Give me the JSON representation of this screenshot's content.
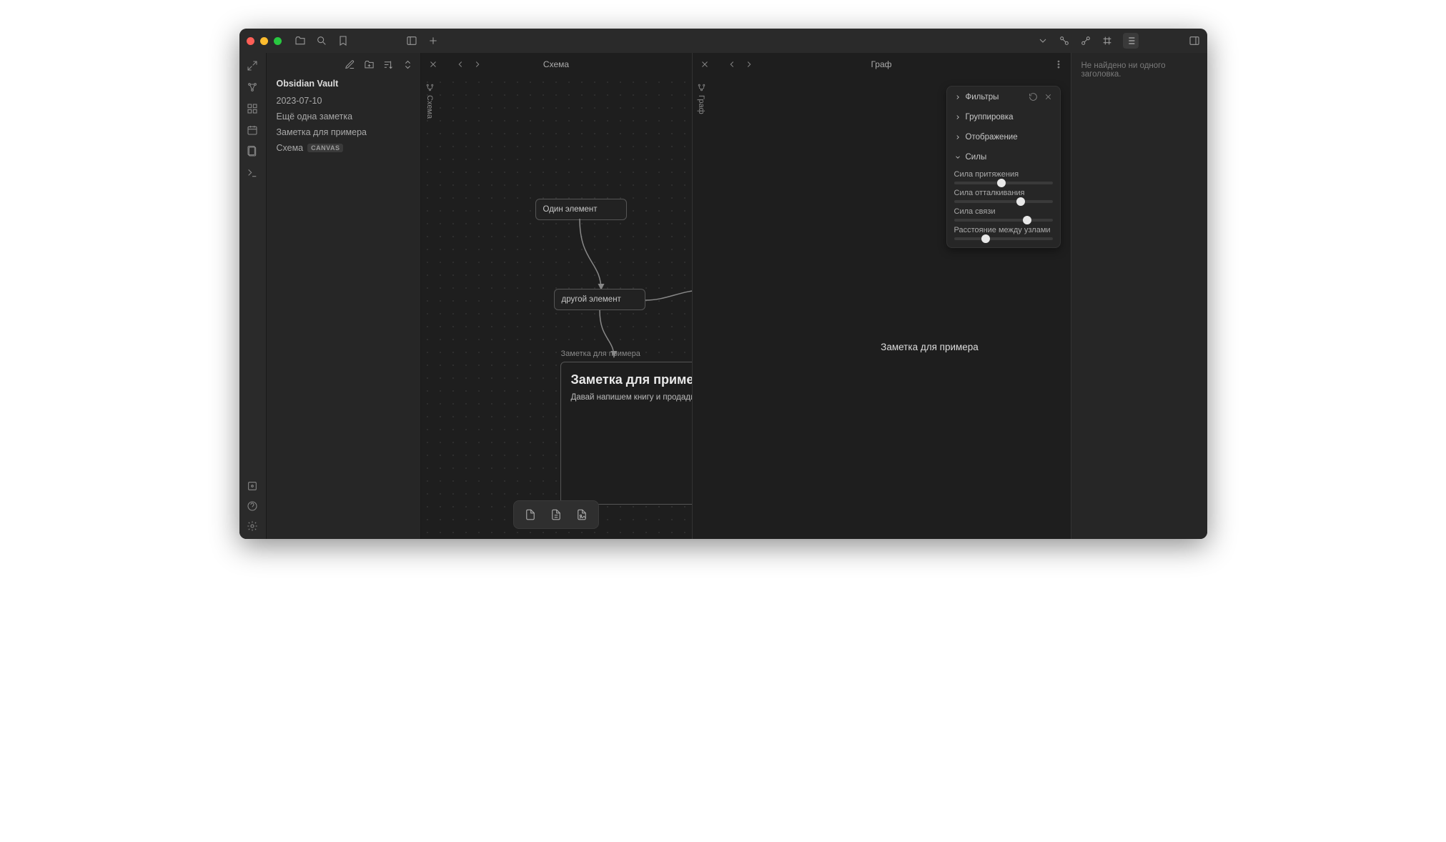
{
  "titlebar": {},
  "explorer": {
    "vault": "Obsidian Vault",
    "files": [
      {
        "name": "2023-07-10"
      },
      {
        "name": "Ещё одна заметка"
      },
      {
        "name": "Заметка для примера"
      },
      {
        "name": "Схема",
        "badge": "CANVAS"
      }
    ]
  },
  "panes": {
    "canvas": {
      "title": "Схема",
      "vtab": "Схема",
      "node1": "Один элемент",
      "node2": "другой элемент",
      "note_label": "Заметка для примера",
      "note_title": "Заметка для примера",
      "note_body": "Давай напишем книгу и продадим её!"
    },
    "graph": {
      "title": "Граф",
      "vtab": "Граф",
      "hover_label": "Заметка для примера",
      "settings": {
        "filters": "Фильтры",
        "groups": "Группировка",
        "display": "Отображение",
        "forces": "Силы",
        "s1": {
          "label": "Сила притяжения",
          "pos": 48
        },
        "s2": {
          "label": "Сила отталкивания",
          "pos": 68
        },
        "s3": {
          "label": "Сила связи",
          "pos": 74
        },
        "s4": {
          "label": "Расстояние между узлами",
          "pos": 32
        }
      }
    },
    "outline": {
      "empty": "Не найдено ни одного заголовка."
    }
  }
}
